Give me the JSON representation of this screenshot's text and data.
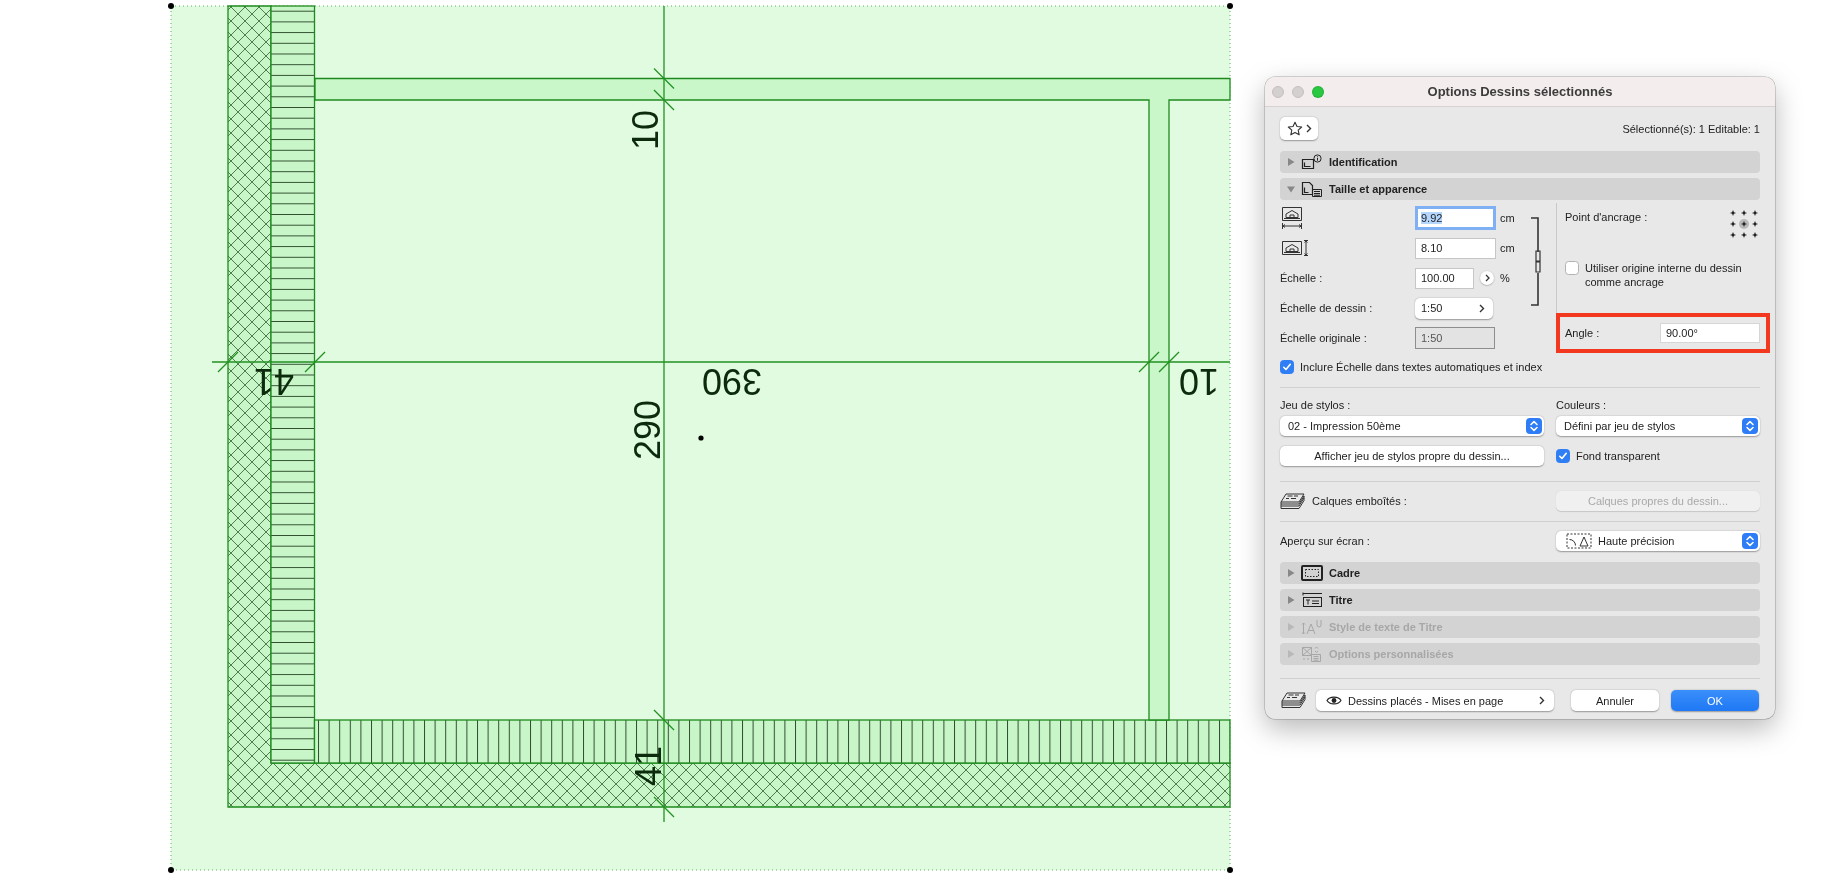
{
  "canvas": {
    "vertical_dimension": [
      "10",
      "290",
      "41"
    ],
    "horizontal_dimension": [
      "41",
      "390",
      "10"
    ]
  },
  "dialog": {
    "title": "Options Dessins sélectionnés",
    "window_controls": [
      {
        "kind": "close",
        "enabled": false
      },
      {
        "kind": "minimize",
        "enabled": false
      },
      {
        "kind": "zoom",
        "enabled": true
      }
    ],
    "selection_info": "Sélectionné(s): 1 Editable: 1",
    "sections": [
      {
        "label": "Identification",
        "expanded": false,
        "disabled": false
      },
      {
        "label": "Taille et apparence",
        "expanded": true,
        "disabled": false
      }
    ],
    "size": {
      "width": {
        "value": "9.92",
        "unit": "cm",
        "focused": true
      },
      "height": {
        "value": "8.10",
        "unit": "cm",
        "focused": false
      },
      "scale": {
        "label": "Échelle :",
        "value": "100.00",
        "unit": "%"
      },
      "drawing_scale": {
        "label": "Échelle de dessin :",
        "value": "1:50"
      },
      "original_scale": {
        "label": "Échelle originale :",
        "value": "1:50",
        "disabled": true
      },
      "proportions_linked": true,
      "anchor": {
        "label": "Point d'ancrage :",
        "points": [
          {
            "selected": false
          },
          {
            "selected": false
          },
          {
            "selected": false
          },
          {
            "selected": false
          },
          {
            "selected": true
          },
          {
            "selected": false
          },
          {
            "selected": false
          },
          {
            "selected": false
          },
          {
            "selected": false
          }
        ]
      },
      "use_internal_origin": {
        "label": "Utiliser origine interne du dessin comme ancrage",
        "checked": false
      },
      "angle": {
        "label": "Angle :",
        "value": "90.00°",
        "highlighted": true
      }
    },
    "include_scale": {
      "label": "Inclure Échelle dans textes automatiques et index",
      "checked": true
    },
    "pen_set": {
      "label": "Jeu de stylos :",
      "value": "02 - Impression 50ème"
    },
    "colors": {
      "label": "Couleurs :",
      "value": "Défini par jeu de stylos"
    },
    "pen_set_button": "Afficher jeu de stylos propre du dessin...",
    "transparent_background": {
      "label": "Fond transparent",
      "checked": true
    },
    "nested_layers": {
      "label": "Calques emboîtés :",
      "button": "Calques propres du dessin...",
      "button_disabled": true
    },
    "screen_preview": {
      "label": "Aperçu sur écran :",
      "value": "Haute précision"
    },
    "more_sections": [
      {
        "label": "Cadre",
        "expanded": false,
        "disabled": false
      },
      {
        "label": "Titre",
        "expanded": false,
        "disabled": false
      },
      {
        "label": "Style de texte de Titre",
        "expanded": false,
        "disabled": true
      },
      {
        "label": "Options personnalisées",
        "expanded": false,
        "disabled": true
      }
    ],
    "footer": {
      "layout_button": "Dessins placés - Mises en page",
      "cancel": "Annuler",
      "ok": "OK"
    }
  }
}
